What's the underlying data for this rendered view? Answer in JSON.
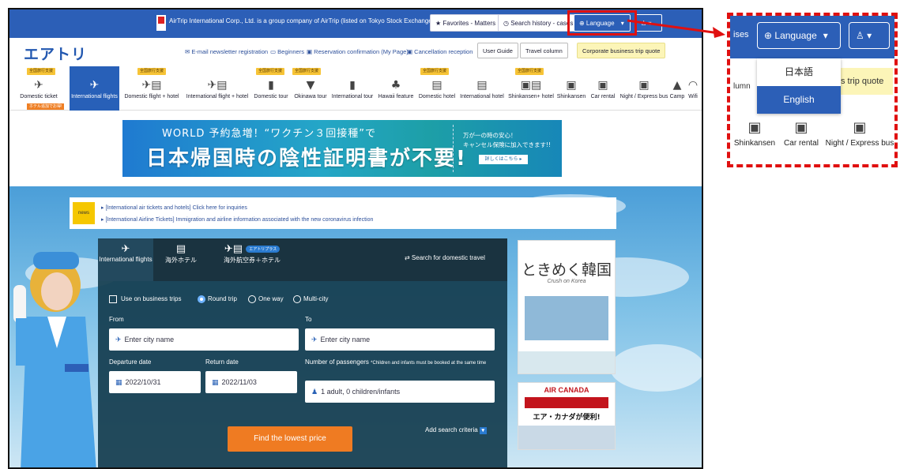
{
  "topbar": {
    "notice": "AirTrip International Corp., Ltd. is a group company of AirTrip (listed on Tokyo Stock Exchange Prime).",
    "favorites": "★ Favorites - Matters",
    "search_history": "◷ Search history - cases",
    "language": "⊕ Language",
    "language_caret": "▾",
    "account": "♙ ▾"
  },
  "header": {
    "logo": "エアトリ",
    "links": [
      "✉ E-mail newsletter registration",
      "▭ Beginners",
      "▣ Reservation confirmation (My Page)",
      "▣ Cancellation reception"
    ],
    "buttons": [
      "User Guide",
      "Travel column",
      "Corporate business trip quote"
    ]
  },
  "nav": {
    "items": [
      {
        "label": "Domestic ticket",
        "icon": "✈"
      },
      {
        "label": "International flights",
        "icon": "✈"
      },
      {
        "label": "Domestic flight + hotel",
        "icon": "✈▤"
      },
      {
        "label": "International flight + hotel",
        "icon": "✈▤"
      },
      {
        "label": "Domestic tour",
        "icon": "▮"
      },
      {
        "label": "Okinawa tour",
        "icon": "▼"
      },
      {
        "label": "International tour",
        "icon": "▮"
      },
      {
        "label": "Hawaii feature",
        "icon": "♣"
      },
      {
        "label": "Domestic hotel",
        "icon": "▤"
      },
      {
        "label": "International hotel",
        "icon": "▤"
      },
      {
        "label": "Shinkansen+ hotel",
        "icon": "▣▤"
      },
      {
        "label": "Shinkansen",
        "icon": "▣"
      },
      {
        "label": "Car rental",
        "icon": "▣"
      },
      {
        "label": "Night / Express bus",
        "icon": "▣"
      },
      {
        "label": "Camp",
        "icon": "▲"
      },
      {
        "label": "Wifi",
        "icon": "◠"
      }
    ],
    "tag_label": "全国旅行支援",
    "hotel_tag": "ホテル追加でお得!"
  },
  "banner": {
    "headline": "WORLD 予約急増！“ワクチン３回接種”で",
    "title": "日本帰国時の陰性証明書が不要!",
    "side_line1": "万が一の時の安心！",
    "side_line2": "キャンセル保険に加入できます!!",
    "side_button": "詳しくはこちら ▸"
  },
  "news": {
    "tag": "news",
    "items": [
      "▸ [International air tickets and hotels] Click here for inquiries",
      "▸ [International Airline Tickets] Immigration and airline information associated with the new coronavirus infection"
    ]
  },
  "search": {
    "tabs": [
      {
        "label": "International flights",
        "icon": "✈"
      },
      {
        "label": "海外ホテル",
        "icon": "▤"
      },
      {
        "label": "海外航空券＋ホテル",
        "icon": "✈▤"
      }
    ],
    "tab_pill": "エアトリプラス",
    "domestic_link": "⇄ Search for domestic travel",
    "business_trip": "Use on business trips",
    "round_trip": "Round trip",
    "one_way": "One way",
    "multi_city": "Multi-city",
    "from_label": "From",
    "to_label": "To",
    "from_placeholder": "Enter city name",
    "to_placeholder": "Enter city name",
    "departure_label": "Departure date",
    "return_label": "Return date",
    "passengers_label": "Number of passengers",
    "passengers_note": "*Children and infants must be booked at the same time",
    "departure_value": "2022/10/31",
    "return_value": "2022/11/03",
    "passengers_value": "1 adult, 0 children/infants",
    "find_button": "Find the lowest price",
    "add_criteria": "Add search criteria"
  },
  "ads": {
    "korea_title": "ときめく韓国",
    "korea_sub": "Crush on Korea",
    "air_canada": "AIR CANADA",
    "air_canada_jp": "エア・カナダが便利!"
  },
  "callout": {
    "cases": "ises",
    "language": "⊕ Language",
    "caret": "▾",
    "account": "♙ ▾",
    "left_text": "lumn",
    "right_text": "s trip quote",
    "options": [
      "日本語",
      "English"
    ],
    "nav": [
      {
        "label": "Shinkansen",
        "icon": "▣"
      },
      {
        "label": "Car rental",
        "icon": "▣"
      },
      {
        "label": "Night / Express bus",
        "icon": "▣"
      }
    ]
  },
  "colors": {
    "brand_blue": "#2c5fb7",
    "highlight_red": "#e01010",
    "cta_orange": "#ef7b22",
    "tag_yellow": "#f7c437"
  }
}
